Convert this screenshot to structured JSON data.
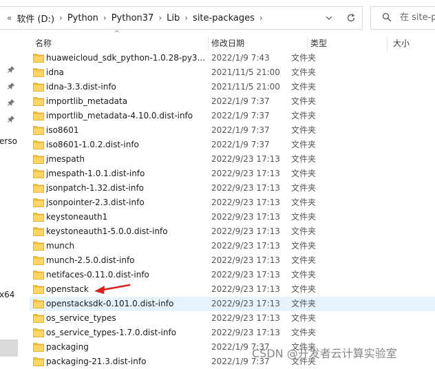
{
  "address_bar": {
    "overflow_label": "«",
    "breadcrumbs": [
      "软件 (D:)",
      "Python",
      "Python37",
      "Lib",
      "site-packages"
    ],
    "search_placeholder": "在 site-pa"
  },
  "nav_pane": {
    "fragments": [
      "erso",
      "x64"
    ]
  },
  "columns": {
    "name": "名称",
    "date": "修改日期",
    "type": "类型",
    "size": "大小"
  },
  "files": [
    {
      "name": "huaweicloud_sdk_python-1.0.28-py3...",
      "date": "2022/1/9 7:43",
      "type": "文件夹"
    },
    {
      "name": "idna",
      "date": "2021/11/5 21:00",
      "type": "文件夹"
    },
    {
      "name": "idna-3.3.dist-info",
      "date": "2021/11/5 21:00",
      "type": "文件夹"
    },
    {
      "name": "importlib_metadata",
      "date": "2022/1/9 7:37",
      "type": "文件夹"
    },
    {
      "name": "importlib_metadata-4.10.0.dist-info",
      "date": "2022/1/9 7:37",
      "type": "文件夹"
    },
    {
      "name": "iso8601",
      "date": "2022/1/9 7:37",
      "type": "文件夹"
    },
    {
      "name": "iso8601-1.0.2.dist-info",
      "date": "2022/1/9 7:37",
      "type": "文件夹"
    },
    {
      "name": "jmespath",
      "date": "2022/9/23 17:13",
      "type": "文件夹"
    },
    {
      "name": "jmespath-1.0.1.dist-info",
      "date": "2022/9/23 17:13",
      "type": "文件夹"
    },
    {
      "name": "jsonpatch-1.32.dist-info",
      "date": "2022/9/23 17:13",
      "type": "文件夹"
    },
    {
      "name": "jsonpointer-2.3.dist-info",
      "date": "2022/9/23 17:13",
      "type": "文件夹"
    },
    {
      "name": "keystoneauth1",
      "date": "2022/9/23 17:13",
      "type": "文件夹"
    },
    {
      "name": "keystoneauth1-5.0.0.dist-info",
      "date": "2022/9/23 17:13",
      "type": "文件夹"
    },
    {
      "name": "munch",
      "date": "2022/9/23 17:13",
      "type": "文件夹"
    },
    {
      "name": "munch-2.5.0.dist-info",
      "date": "2022/9/23 17:13",
      "type": "文件夹"
    },
    {
      "name": "netifaces-0.11.0.dist-info",
      "date": "2022/9/23 17:13",
      "type": "文件夹"
    },
    {
      "name": "openstack",
      "date": "2022/9/23 17:13",
      "type": "文件夹"
    },
    {
      "name": "openstacksdk-0.101.0.dist-info",
      "date": "2022/9/23 17:13",
      "type": "文件夹",
      "selected": true
    },
    {
      "name": "os_service_types",
      "date": "2022/9/23 17:13",
      "type": "文件夹"
    },
    {
      "name": "os_service_types-1.7.0.dist-info",
      "date": "2022/9/23 17:13",
      "type": "文件夹"
    },
    {
      "name": "packaging",
      "date": "2022/1/9 7:37",
      "type": "文件夹"
    },
    {
      "name": "packaging-21.3.dist-info",
      "date": "2022/1/9 7:37",
      "type": "文件夹"
    }
  ],
  "watermark": "CSDN @开发者云计算实验室",
  "colors": {
    "folder": "#f5c542",
    "selected_row": "#e5f3ff",
    "annotation_arrow": "#e02020"
  }
}
